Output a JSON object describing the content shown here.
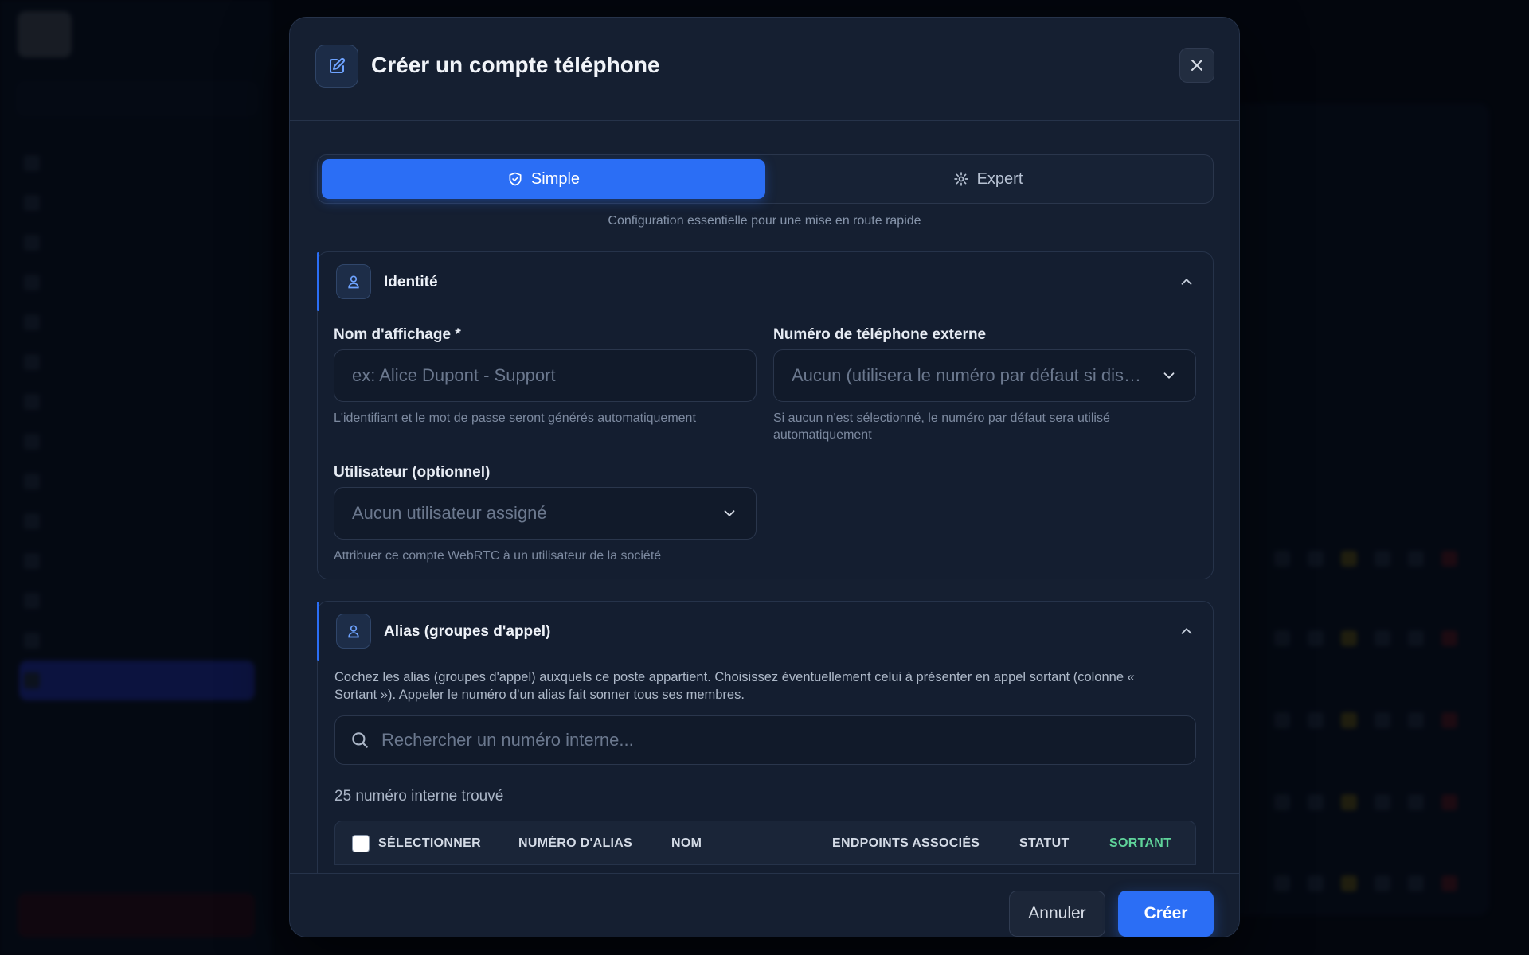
{
  "modal": {
    "title": "Créer un compte téléphone",
    "close_label": "×"
  },
  "mode": {
    "simple_label": "Simple",
    "expert_label": "Expert",
    "selected": "Simple",
    "caption": "Configuration essentielle pour une mise en route rapide"
  },
  "identity": {
    "title": "Identité",
    "display_name": {
      "label": "Nom d'affichage *",
      "placeholder": "ex: Alice Dupont - Support",
      "value": "",
      "hint": "L'identifiant et le mot de passe seront générés automatiquement"
    },
    "external_number": {
      "label": "Numéro de téléphone externe",
      "selected": "Aucun (utilisera le numéro par défaut si disponible)",
      "hint": "Si aucun n'est sélectionné, le numéro par défaut sera utilisé automatiquement"
    },
    "user": {
      "label": "Utilisateur (optionnel)",
      "selected": "Aucun utilisateur assigné",
      "hint": "Attribuer ce compte WebRTC à un utilisateur de la société"
    }
  },
  "alias": {
    "title": "Alias (groupes d'appel)",
    "description": "Cochez les alias (groupes d'appel) auxquels ce poste appartient. Choisissez éventuellement celui à présenter en appel sortant (colonne « Sortant »). Appeler le numéro d'un alias fait sonner tous ses membres.",
    "search_placeholder": "Rechercher un numéro interne...",
    "count_text": "25 numéro interne trouvé",
    "columns": [
      "SÉLECTIONNER",
      "NUMÉRO D'ALIAS",
      "NOM",
      "ENDPOINTS ASSOCIÉS",
      "STATUT",
      "SORTANT"
    ]
  },
  "footer": {
    "cancel_label": "Annuler",
    "create_label": "Créer"
  },
  "colors": {
    "accent": "#2b6ef5",
    "modal_bg": "#151f31",
    "outgoing_column": "#5fd39a"
  }
}
